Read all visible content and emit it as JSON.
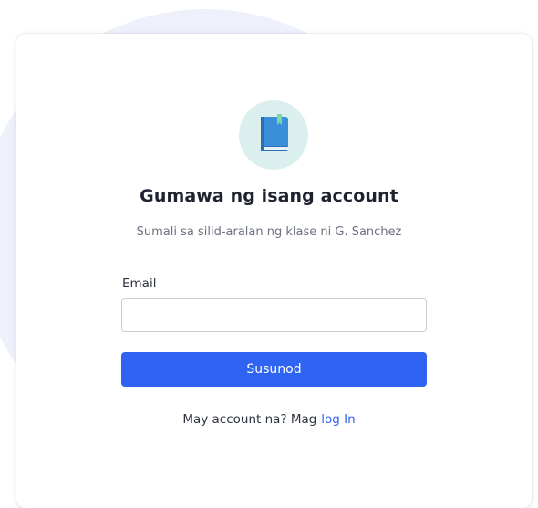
{
  "brand": {
    "logo_icon": "book-icon",
    "logo_bg_color": "#dcefef",
    "book_color": "#3b8fd9",
    "bookmark_color": "#7ed6a0"
  },
  "header": {
    "title": "Gumawa ng isang account",
    "subtitle": "Sumali sa silid-aralan ng klase ni G. Sanchez"
  },
  "form": {
    "email_label": "Email",
    "email_value": "",
    "email_placeholder": "",
    "submit_label": "Susunod",
    "accent_color": "#2f63f2"
  },
  "footer": {
    "prompt": "May account na? Mag-",
    "login_link": "log In"
  }
}
